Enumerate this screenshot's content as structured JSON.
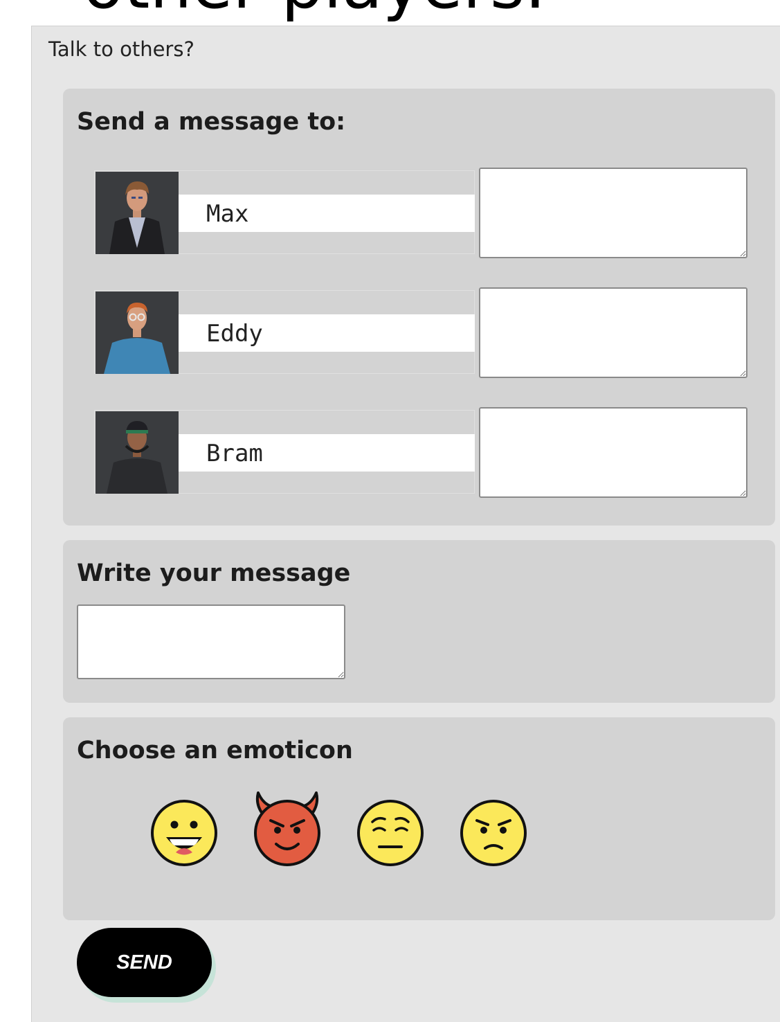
{
  "page": {
    "heading": "other players.",
    "intro": "Talk to others?"
  },
  "recipients_section": {
    "title": "Send a message to:",
    "recipients": [
      {
        "name": "Max",
        "message": ""
      },
      {
        "name": "Eddy",
        "message": ""
      },
      {
        "name": "Bram",
        "message": ""
      }
    ]
  },
  "message_section": {
    "title": "Write your message",
    "message": ""
  },
  "emoticon_section": {
    "title": "Choose an emoticon",
    "emoticons": [
      "grinning-face",
      "smiling-face-with-horns",
      "relieved-face",
      "angry-face"
    ]
  },
  "send_button": {
    "label": "SEND"
  },
  "colors": {
    "panel": "#e6e6e6",
    "section": "#d3d3d3",
    "button": "#000000",
    "button_shadow": "#c6e3d8",
    "emoji_yellow": "#fbe85a",
    "emoji_red": "#e25c41"
  }
}
